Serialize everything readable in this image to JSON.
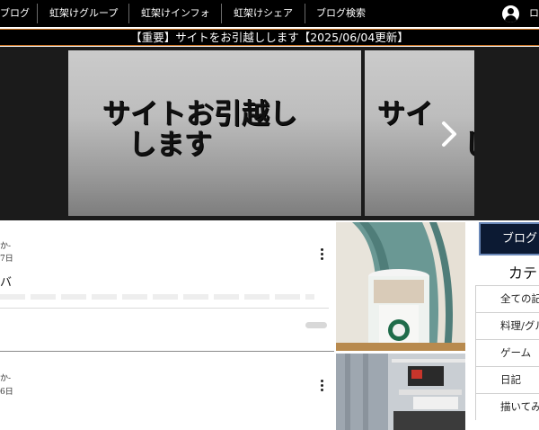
{
  "nav": {
    "items": [
      "ブログ",
      "虹架けグループ",
      "虹架けインフォ",
      "虹架けシェア",
      "ブログ検索"
    ],
    "login_label": "ロ"
  },
  "notice": {
    "text": "【重要】サイトをお引越しします【2025/06/04更新】"
  },
  "slider": {
    "slide1_line1": "サイトお引越し",
    "slide1_line2": "します",
    "slide2_line1": "サイ",
    "slide2_line2": "し"
  },
  "posts": [
    {
      "author": "か‐",
      "date": "7日",
      "title": "バ",
      "has_menu": true
    },
    {
      "author": "か‐",
      "date": "6日",
      "has_menu": true
    }
  ],
  "sidebar": {
    "blog_button": "ブログ",
    "category_heading": "カテ",
    "categories": [
      "全ての記",
      "料理/グル",
      "ゲーム",
      "日記",
      "描いてみ"
    ]
  },
  "colors": {
    "nav_bg": "#000000",
    "notice_border": "#c96d1a",
    "blog_button_bg": "#0c1a33"
  },
  "icons": {
    "user": "user-icon",
    "next": "chevron-right-icon",
    "more": "kebab-menu-icon"
  }
}
